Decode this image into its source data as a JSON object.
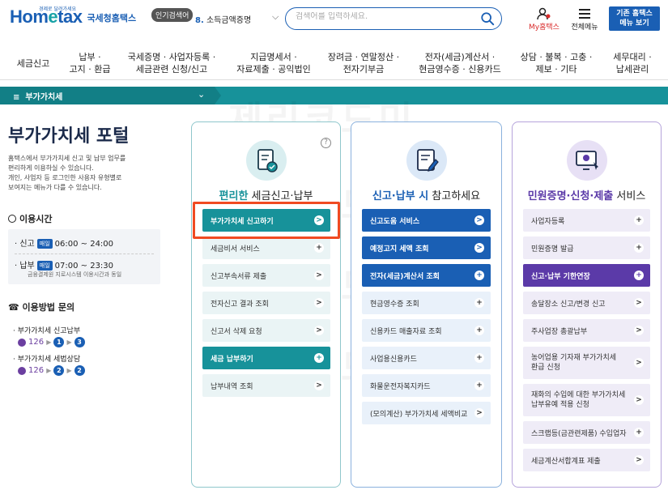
{
  "header": {
    "logo_text_a": "Hom",
    "logo_text_e": "e",
    "logo_text_b": "tax",
    "logo_sub": "국세청홈택스",
    "logo_tiny": "경제로 달려가세요",
    "popular_badge": "인기검색어",
    "popular_num": "8.",
    "popular_text": "소득금액증명",
    "search_placeholder": "검색어를 입력하세요.",
    "my_label": "My홈택스",
    "menu_label": "전체메뉴",
    "basic_btn_line1": "기존 홈택스",
    "basic_btn_line2": "메뉴 보기"
  },
  "gnb": [
    {
      "l1": "세금신고",
      "l2": ""
    },
    {
      "l1": "납부 ·",
      "l2": "고지 · 환급"
    },
    {
      "l1": "국세증명 · 사업자등록 ·",
      "l2": "세금관련 신청/신고"
    },
    {
      "l1": "지급명세서 ·",
      "l2": "자료제출 · 공익법인"
    },
    {
      "l1": "장려금 · 연말정산 ·",
      "l2": "전자기부금"
    },
    {
      "l1": "전자(세금)계산서 ·",
      "l2": "현금영수증 · 신용카드"
    },
    {
      "l1": "상담 · 불복 · 고충 ·",
      "l2": "제보 · 기타"
    },
    {
      "l1": "세무대리 ·",
      "l2": "납세관리"
    }
  ],
  "band": {
    "label": "부가가치세"
  },
  "watermark": "제리코드미",
  "left": {
    "title_a": "부가가치세",
    "title_b": " 포털",
    "desc": [
      "홈택스에서 부가가치세 신고 및 납부 업무를",
      "편리하게 이용하실 수 있습니다.",
      "개인, 사업자 등 로그인한 사용자 유형별로",
      "보여지는 메뉴가 다를 수 있습니다."
    ],
    "usage_title": "이용시간",
    "time1_label": "· 신고",
    "time1_badge": "매일",
    "time1_value": "06:00 ~ 24:00",
    "time2_label": "· 납부",
    "time2_badge": "매일",
    "time2_value": "07:00 ~ 23:30",
    "time_note": "금융결제원 지로시스템 이용시간과 동일",
    "inquiry_title": "이용방법 문의",
    "inq1": "· 부가가치세 신고납부",
    "inq1_phone": "126",
    "inq1_n1": "1",
    "inq1_n2": "3",
    "inq2": "· 부가가치세 세법상담",
    "inq2_phone": "126",
    "inq2_n1": "2",
    "inq2_n2": "2"
  },
  "card1": {
    "title_a": "편리한",
    "title_b": " 세금신고·납부",
    "help": "?",
    "items": [
      {
        "label": "부가가치세 신고하기",
        "icon": ">"
      },
      {
        "label": "세금비서 서비스",
        "icon": "+"
      },
      {
        "label": "신고부속서류 제출",
        "icon": ">"
      },
      {
        "label": "전자신고 결과 조회",
        "icon": ">"
      },
      {
        "label": "신고서 삭제 요청",
        "icon": ">"
      },
      {
        "label": "세금 납부하기",
        "icon": "+"
      },
      {
        "label": "납부내역 조회",
        "icon": ">"
      }
    ]
  },
  "card2": {
    "title_a": "신고·납부 시",
    "title_b": " 참고하세요",
    "items": [
      {
        "label": "신고도움 서비스",
        "icon": ">"
      },
      {
        "label": "예정고지 세액 조회",
        "icon": ">"
      },
      {
        "label": "전자(세금)계산서 조회",
        "icon": "+"
      },
      {
        "label": "현금영수증 조회",
        "icon": "+"
      },
      {
        "label": "신용카드 매출자료 조회",
        "icon": "+"
      },
      {
        "label": "사업용신용카드",
        "icon": "+"
      },
      {
        "label": "화물운전자복지카드",
        "icon": "+"
      },
      {
        "label": "(모의계산) 부가가치세 세액비교",
        "icon": ">"
      }
    ]
  },
  "card3": {
    "title_a": "민원증명·신청·제출",
    "title_b": " 서비스",
    "items": [
      {
        "label": "사업자등록",
        "label2": "",
        "icon": "+"
      },
      {
        "label": "민원증명 발급",
        "label2": "",
        "icon": "+"
      },
      {
        "label": "신고·납부 기한연장",
        "label2": "",
        "icon": "+"
      },
      {
        "label": "송달장소 신고/변경 신고",
        "label2": "",
        "icon": ">"
      },
      {
        "label": "주사업장 총괄납부",
        "label2": "",
        "icon": ">"
      },
      {
        "label": "농어업용 기자재 부가가치세",
        "label2": "환급 신청",
        "icon": ">"
      },
      {
        "label": "재화의 수입에 대한 부가가치세",
        "label2": "납부유예 적용 신청",
        "icon": ">"
      },
      {
        "label": "스크랩등(금관련제품) 수입업자",
        "label2": "",
        "icon": "+"
      },
      {
        "label": "세금계산서합계표 제출",
        "label2": "",
        "icon": ">"
      }
    ]
  },
  "colors": {
    "teal": "#17929a",
    "blue": "#1a5fb4",
    "purple": "#5b3aa8",
    "highlight": "#f04a22"
  }
}
